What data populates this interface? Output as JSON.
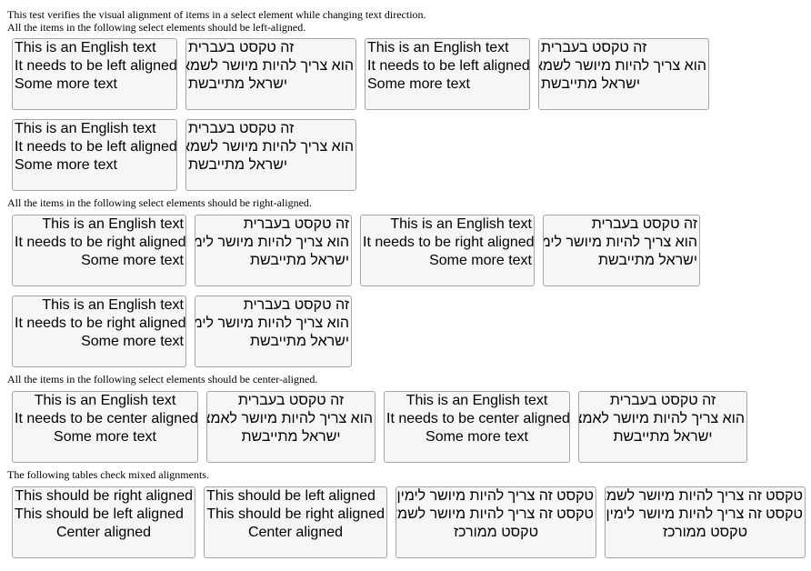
{
  "intro": {
    "line1": "This test verifies the visual alignment of items in a select element while changing text direction.",
    "line2": "All the items in the following select elements should be left-aligned."
  },
  "sections": {
    "right_heading": "All the items in the following select elements should be right-aligned.",
    "center_heading": "All the items in the following select elements should be center-aligned.",
    "mixed_heading": "The following tables check mixed alignments."
  },
  "english_left": [
    "This is an English text",
    "It needs to be left aligned",
    "Some more text"
  ],
  "hebrew_left": [
    "זה טקסט בעברית",
    "הוא צריך להיות מיושר לשמאל",
    "ישראל מתייבשת"
  ],
  "english_right": [
    "This is an English text",
    "It needs to be right aligned",
    "Some more text"
  ],
  "hebrew_right": [
    "זה טקסט בעברית",
    "הוא צריך להיות מיושר לימין",
    "ישראל מתייבשת"
  ],
  "english_center": [
    "This is an English text",
    "It needs to be center aligned",
    "Some more text"
  ],
  "hebrew_center": [
    "זה טקסט בעברית",
    "הוא צריך להיות מיושר לאמצע",
    "ישראל מתייבשת"
  ],
  "mixed_en_1": [
    "This should be right aligned",
    "This should be left aligned",
    "Center aligned"
  ],
  "mixed_en_2": [
    "This should be left aligned",
    "This should be right aligned",
    "Center aligned"
  ],
  "mixed_he_1": [
    "טקסט זה צריך להיות מיושר לימין",
    "טקסט זה צריך להיות מיושר לשמאל",
    "טקסט ממורכז"
  ],
  "mixed_he_2": [
    "טקסט זה צריך להיות מיושר לשמאל",
    "טקסט זה צריך להיות מיושר לימין",
    "טקסט ממורכז"
  ]
}
